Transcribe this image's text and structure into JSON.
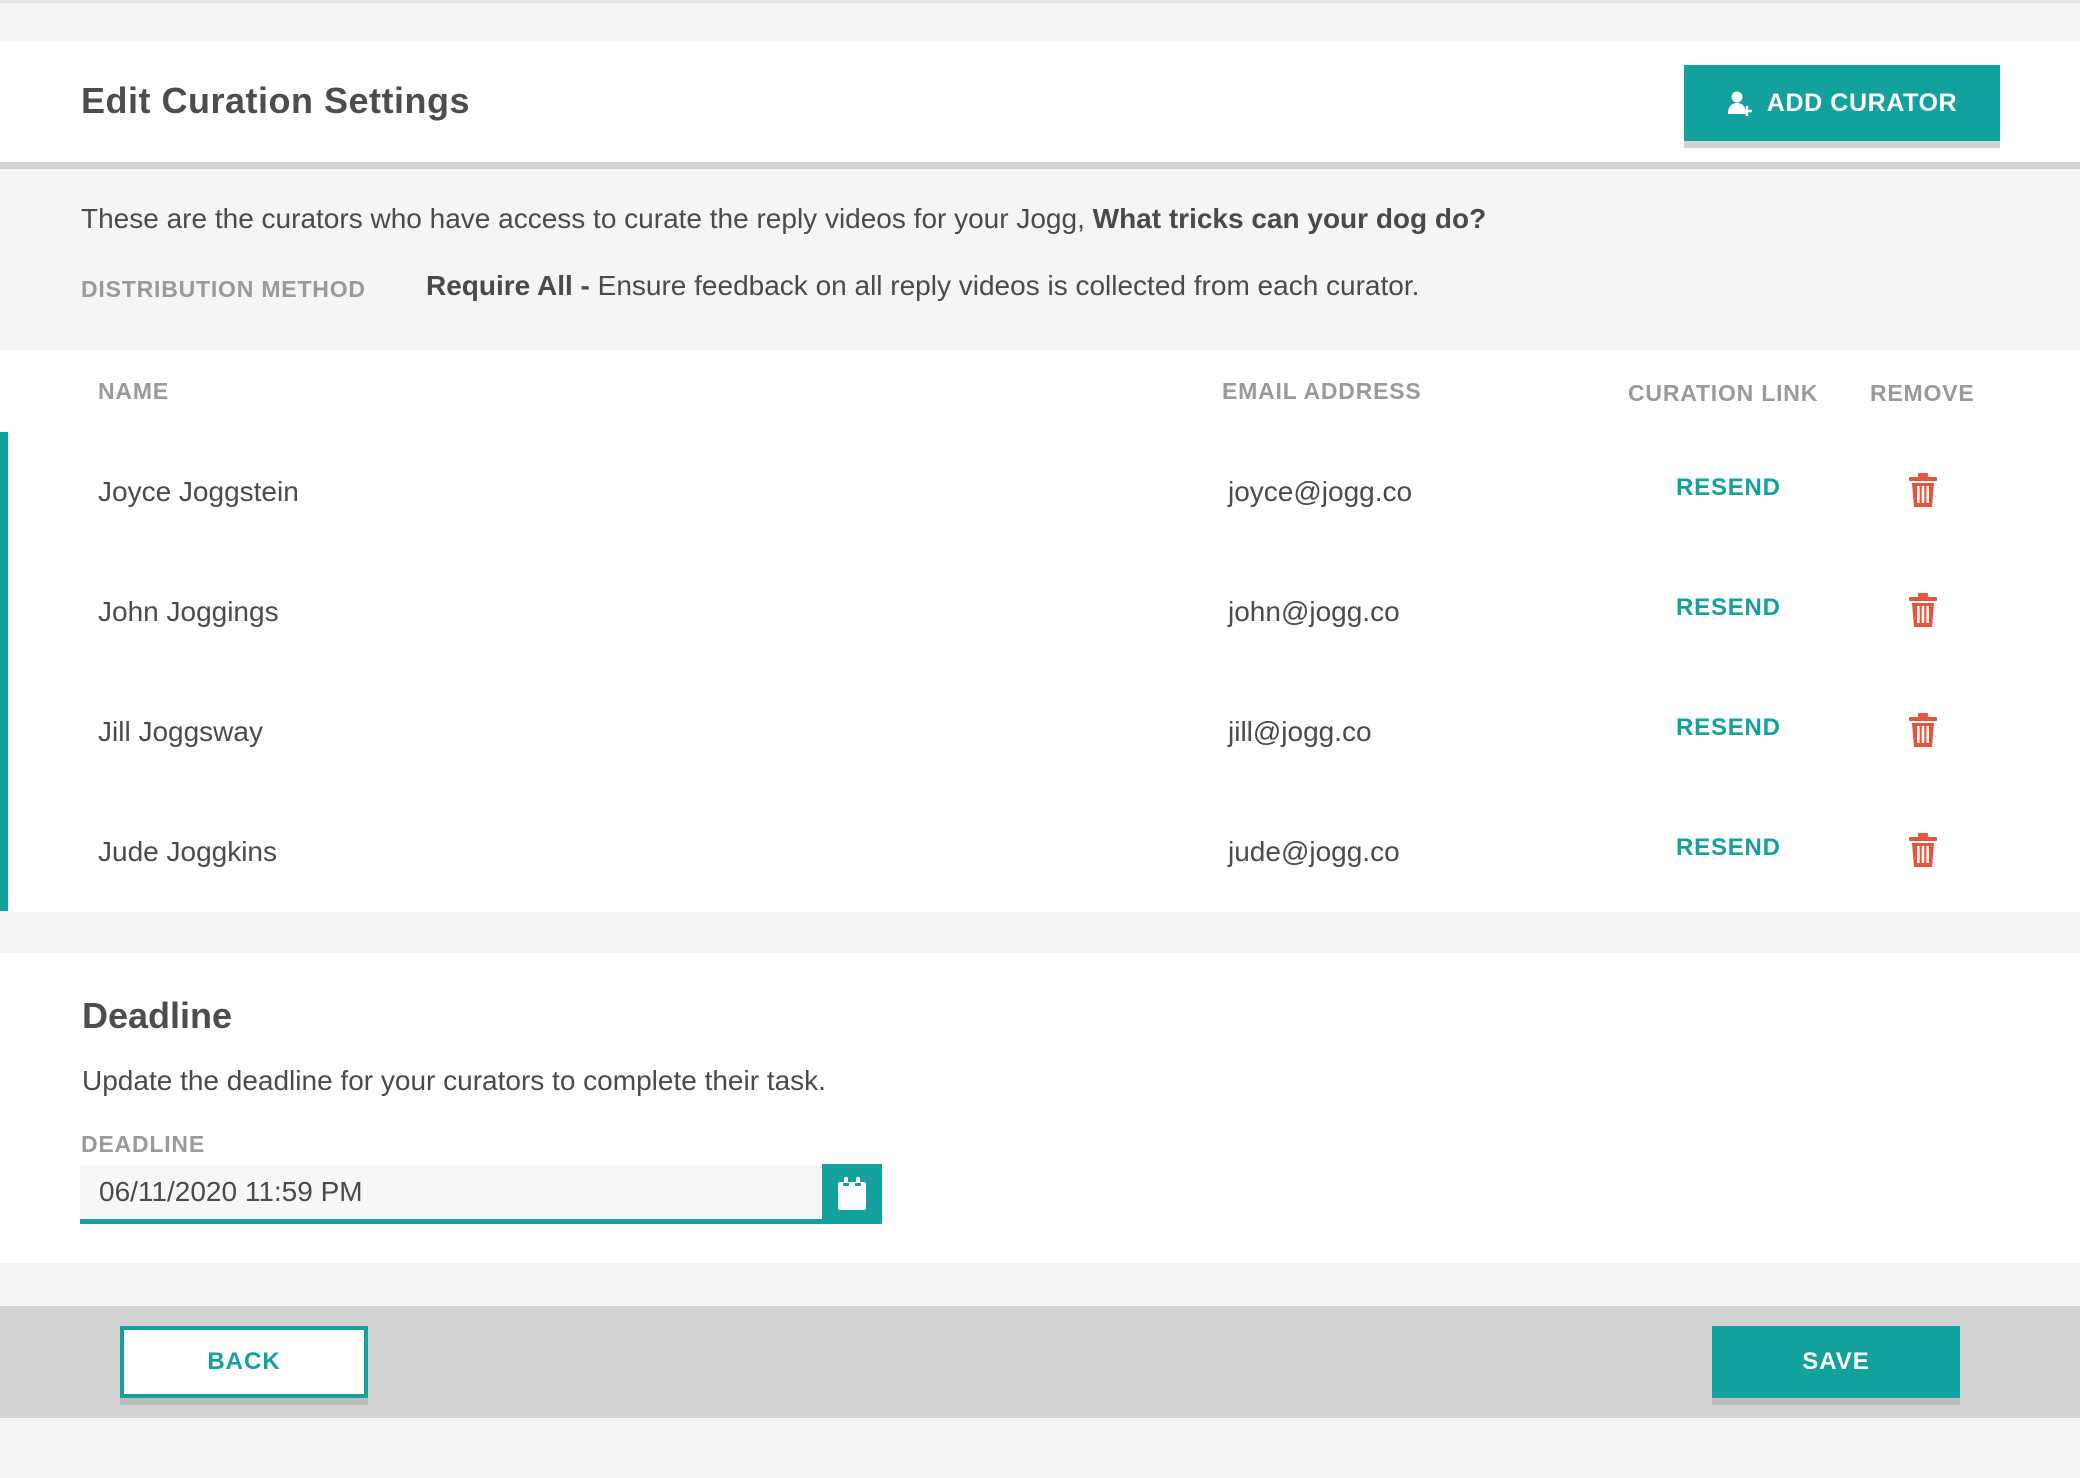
{
  "header": {
    "title": "Edit Curation Settings",
    "add_button_label": "ADD CURATOR"
  },
  "intro": {
    "text": "These are the curators who have access to curate the reply videos for your Jogg,",
    "jogg_title": "What tricks can your dog do?",
    "distribution_label": "DISTRIBUTION METHOD",
    "distribution_method": "Require All -",
    "distribution_description": "Ensure feedback on all reply videos is collected from each curator."
  },
  "table": {
    "columns": {
      "name": "NAME",
      "email": "EMAIL ADDRESS",
      "link": "CURATION LINK",
      "remove": "REMOVE"
    },
    "rows": [
      {
        "name": "Joyce Joggstein",
        "email": "joyce@jogg.co",
        "action": "RESEND"
      },
      {
        "name": "John Joggings",
        "email": "john@jogg.co",
        "action": "RESEND"
      },
      {
        "name": "Jill Joggsway",
        "email": "jill@jogg.co",
        "action": "RESEND"
      },
      {
        "name": "Jude Joggkins",
        "email": "jude@jogg.co",
        "action": "RESEND"
      }
    ]
  },
  "deadline": {
    "title": "Deadline",
    "description": "Update the deadline for your curators to complete their task.",
    "field_label": "DEADLINE",
    "value": "06/11/2020 11:59 PM"
  },
  "footer": {
    "back_label": "BACK",
    "save_label": "SAVE"
  },
  "icons": {
    "add_curator": "add-user-icon",
    "remove": "trash-icon",
    "date_picker": "calendar-icon"
  },
  "colors": {
    "accent": "#13a19e",
    "danger": "#e8533a",
    "muted_label": "#9a9a9a",
    "footer_bar": "#d3d3d3"
  }
}
